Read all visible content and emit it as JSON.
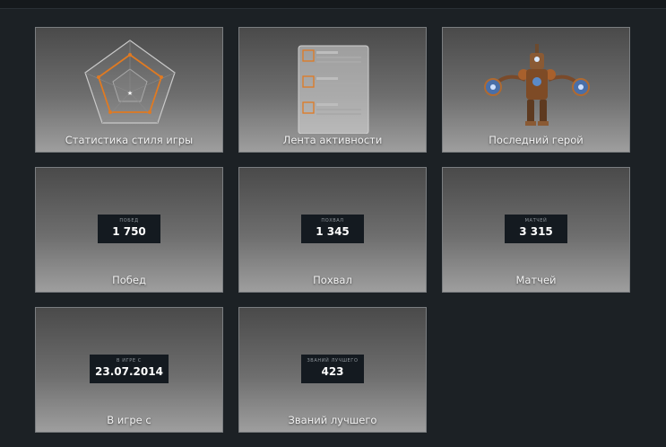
{
  "tiles": {
    "playstyle": {
      "label": "Статистика стиля игры"
    },
    "activity": {
      "label": "Лента активности"
    },
    "last_hero": {
      "label": "Последний герой"
    },
    "wins": {
      "caption": "побед",
      "value": "1 750",
      "label": "Побед"
    },
    "commends": {
      "caption": "похвал",
      "value": "1 345",
      "label": "Похвал"
    },
    "matches": {
      "caption": "матчей",
      "value": "3 315",
      "label": "Матчей"
    },
    "playing_since": {
      "caption": "в игре с",
      "value": "23.07.2014",
      "label": "В игре с"
    },
    "best_ranks": {
      "caption": "званий лучшего",
      "value": "423",
      "label": "Званий лучшего"
    }
  },
  "colors": {
    "accent_orange": "#e07a22",
    "background": "#1c2125",
    "stat_box": "#141a20"
  },
  "icons": {
    "playstyle": "pentagon-radar-icon",
    "activity": "activity-feed-icon",
    "last_hero": "hero-portrait-icon"
  }
}
